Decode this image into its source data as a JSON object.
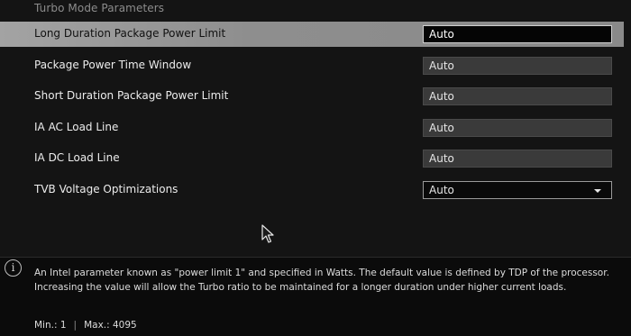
{
  "section": {
    "title": "Turbo Mode Parameters"
  },
  "settings": [
    {
      "label": "Long Duration Package Power Limit",
      "value": "Auto",
      "selected": true
    },
    {
      "label": "Package Power Time Window",
      "value": "Auto"
    },
    {
      "label": "Short Duration Package Power Limit",
      "value": "Auto"
    },
    {
      "label": "IA AC Load Line",
      "value": "Auto"
    },
    {
      "label": "IA DC Load Line",
      "value": "Auto"
    },
    {
      "label": "TVB Voltage Optimizations",
      "value": "Auto",
      "control": "dropdown"
    }
  ],
  "help": {
    "icon": "info-icon",
    "text": "An Intel parameter known as \"power limit 1\" and specified in Watts. The default value is defined by TDP of the processor. Increasing the value will allow the Turbo ratio to be maintained for a longer duration under higher current loads.",
    "min_label": "Min.: 1",
    "separator": "|",
    "max_label": "Max.: 4095"
  },
  "colors": {
    "background": "#141414",
    "selected_row": "#9a9a9a",
    "field_bg": "#3a3a3a"
  }
}
